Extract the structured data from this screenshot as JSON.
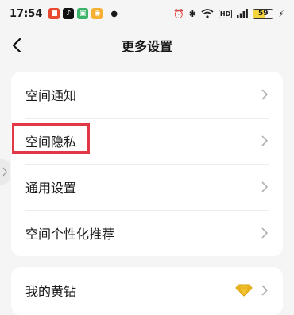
{
  "status_bar": {
    "time": "17:54",
    "battery": "59",
    "icons": [
      "app-icon-1",
      "tiktok-icon",
      "app-icon-3",
      "weibo-icon",
      "alarm-icon",
      "bluetooth-icon",
      "wifi-icon",
      "signal-icon",
      "battery-icon",
      "charging-icon"
    ]
  },
  "header": {
    "title": "更多设置"
  },
  "settings": {
    "items": [
      {
        "label": "空间通知"
      },
      {
        "label": "空间隐私"
      },
      {
        "label": "通用设置"
      },
      {
        "label": "空间个性化推荐"
      }
    ]
  },
  "vip": {
    "label": "我的黄钻"
  },
  "colors": {
    "highlight": "#e23744",
    "diamond": "#f4c430",
    "background": "#f5f5f5",
    "card": "#ffffff"
  }
}
